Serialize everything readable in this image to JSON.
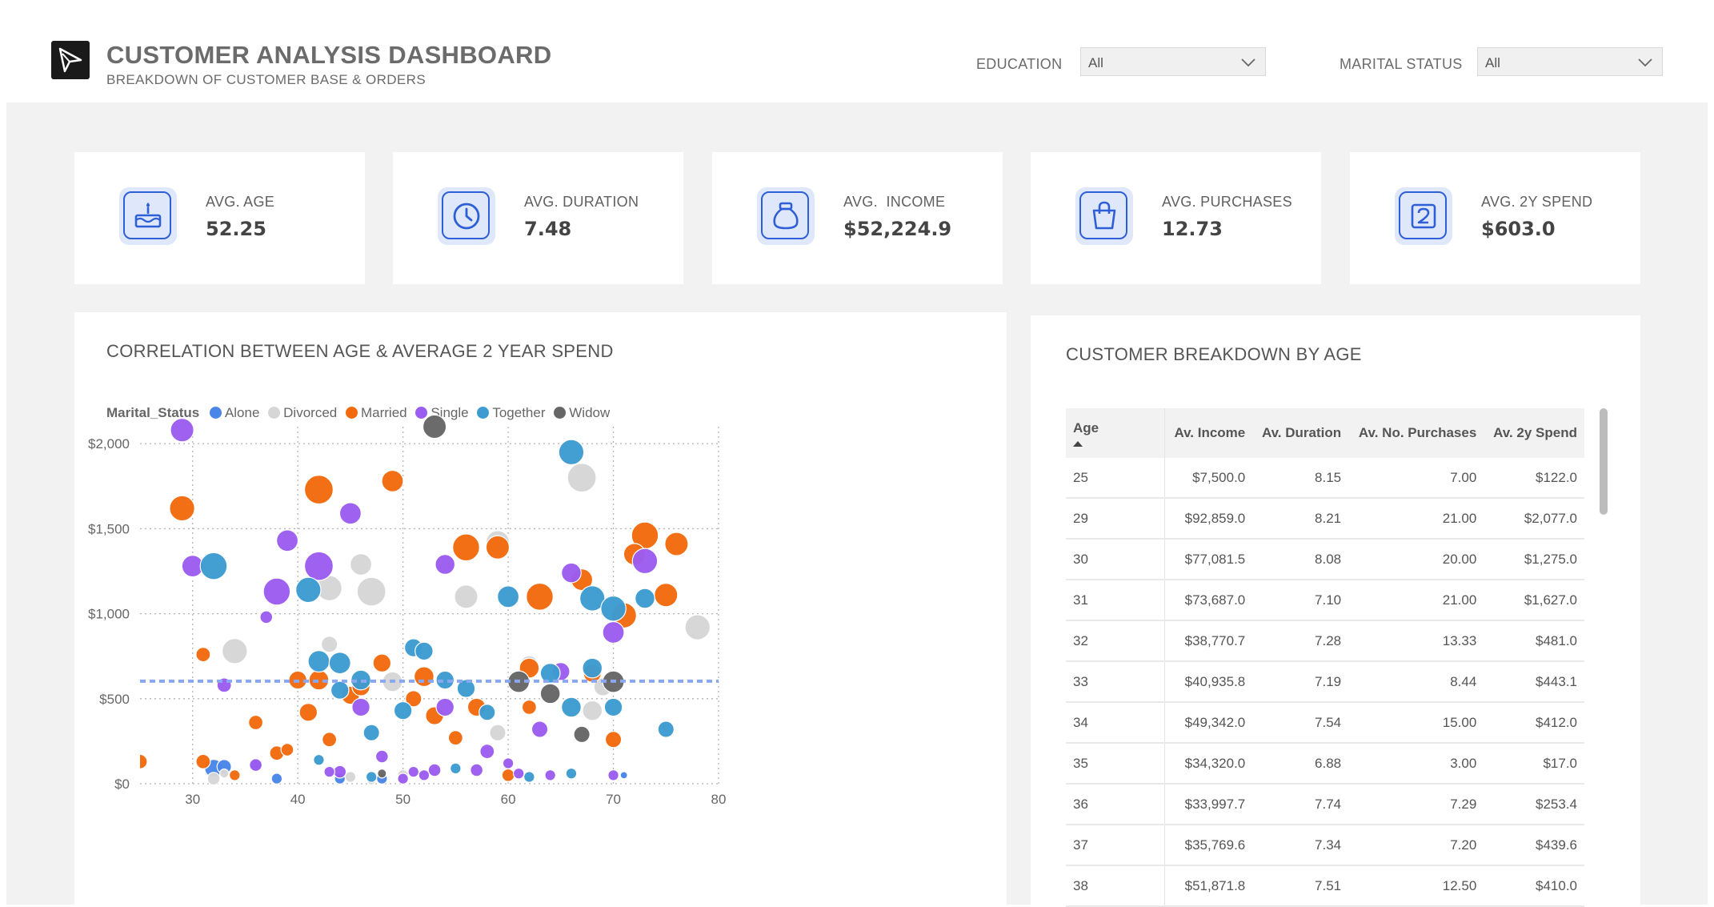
{
  "header": {
    "title": "CUSTOMER ANALYSIS DASHBOARD",
    "subtitle": "BREAKDOWN OF CUSTOMER BASE & ORDERS",
    "filters": [
      {
        "label": "EDUCATION",
        "value": "All"
      },
      {
        "label": "MARITAL STATUS",
        "value": "All"
      }
    ]
  },
  "kpis": [
    {
      "label": "AVG. AGE",
      "value": "52.25",
      "icon": "cake-icon"
    },
    {
      "label": "AVG. DURATION",
      "value": "7.48",
      "icon": "clock-icon"
    },
    {
      "label": "AVG.  INCOME",
      "value": "$52,224.9",
      "icon": "money-bag-icon"
    },
    {
      "label": "AVG. PURCHASES",
      "value": "12.73",
      "icon": "shopping-bag-icon"
    },
    {
      "label": "AVG. 2Y SPEND",
      "value": "$603.0",
      "icon": "number-two-icon"
    }
  ],
  "colors": {
    "Alone": "#4a86e8",
    "Divorced": "#d6d6d6",
    "Married": "#f26a0d",
    "Single": "#9b5cf0",
    "Together": "#3d9bd1",
    "Widow": "#666666",
    "avg_line": "#8aa8f2",
    "kpi_icon": "#2f5fd6"
  },
  "scatter": {
    "title": "CORRELATION BETWEEN AGE & AVERAGE 2 YEAR SPEND",
    "legend_title": "Marital_Status",
    "categories": [
      "Alone",
      "Divorced",
      "Married",
      "Single",
      "Together",
      "Widow"
    ]
  },
  "chart_data": {
    "type": "scatter",
    "xlim": [
      25,
      80
    ],
    "ylim": [
      0,
      2100
    ],
    "x_ticks": [
      30,
      40,
      50,
      60,
      70,
      80
    ],
    "y_ticks": [
      0,
      500,
      1000,
      1500,
      2000
    ],
    "y_tick_labels": [
      "$0",
      "$500",
      "$1,000",
      "$1,500",
      "$2,000"
    ],
    "grid": true,
    "legend_position": "top-left",
    "average_line": 603,
    "series": [
      {
        "name": "Alone",
        "points": [
          [
            32,
            90,
            10
          ],
          [
            71,
            50,
            4
          ],
          [
            48,
            30,
            6
          ],
          [
            44,
            30,
            6
          ],
          [
            38,
            30,
            6
          ],
          [
            33,
            100,
            8
          ],
          [
            36,
            110,
            7
          ]
        ]
      },
      {
        "name": "Divorced",
        "points": [
          [
            67,
            1800,
            16
          ],
          [
            78,
            920,
            14
          ],
          [
            59,
            1420,
            13
          ],
          [
            43,
            1150,
            14
          ],
          [
            47,
            1130,
            16
          ],
          [
            46,
            1290,
            12
          ],
          [
            56,
            1100,
            13
          ],
          [
            34,
            780,
            14
          ],
          [
            43,
            820,
            9
          ],
          [
            68,
            430,
            11
          ],
          [
            49,
            600,
            11
          ],
          [
            69,
            570,
            10
          ],
          [
            59,
            300,
            9
          ],
          [
            62,
            700,
            10
          ],
          [
            32,
            30,
            7
          ],
          [
            50,
            50,
            6
          ],
          [
            47,
            20,
            5
          ],
          [
            45,
            40,
            6
          ],
          [
            33,
            60,
            5
          ]
        ]
      },
      {
        "name": "Married",
        "points": [
          [
            29,
            1620,
            14
          ],
          [
            42,
            1730,
            16
          ],
          [
            49,
            1780,
            12
          ],
          [
            56,
            1390,
            15
          ],
          [
            59,
            1390,
            13
          ],
          [
            63,
            1100,
            15
          ],
          [
            67,
            1200,
            12
          ],
          [
            71,
            990,
            14
          ],
          [
            73,
            1460,
            15
          ],
          [
            76,
            1410,
            13
          ],
          [
            75,
            1110,
            13
          ],
          [
            72,
            1350,
            12
          ],
          [
            31,
            760,
            8
          ],
          [
            40,
            610,
            10
          ],
          [
            41,
            420,
            10
          ],
          [
            36,
            360,
            8
          ],
          [
            38,
            180,
            8
          ],
          [
            39,
            200,
            7
          ],
          [
            43,
            260,
            8
          ],
          [
            45,
            520,
            10
          ],
          [
            46,
            570,
            10
          ],
          [
            48,
            710,
            10
          ],
          [
            51,
            500,
            9
          ],
          [
            53,
            400,
            10
          ],
          [
            55,
            270,
            8
          ],
          [
            57,
            450,
            10
          ],
          [
            62,
            450,
            8
          ],
          [
            68,
            650,
            10
          ],
          [
            70,
            260,
            9
          ],
          [
            62,
            680,
            11
          ],
          [
            52,
            630,
            11
          ],
          [
            25,
            130,
            8
          ],
          [
            31,
            130,
            8
          ],
          [
            34,
            50,
            6
          ],
          [
            60,
            50,
            7
          ],
          [
            42,
            610,
            11
          ]
        ]
      },
      {
        "name": "Single",
        "points": [
          [
            29,
            2080,
            13
          ],
          [
            30,
            1280,
            12
          ],
          [
            38,
            1130,
            15
          ],
          [
            39,
            1430,
            12
          ],
          [
            42,
            1280,
            16
          ],
          [
            45,
            1590,
            12
          ],
          [
            37,
            980,
            7
          ],
          [
            54,
            1290,
            11
          ],
          [
            66,
            1240,
            11
          ],
          [
            73,
            1310,
            14
          ],
          [
            70,
            890,
            12
          ],
          [
            33,
            580,
            8
          ],
          [
            46,
            450,
            10
          ],
          [
            54,
            450,
            10
          ],
          [
            58,
            190,
            8
          ],
          [
            63,
            320,
            9
          ],
          [
            65,
            660,
            10
          ],
          [
            48,
            160,
            7
          ],
          [
            36,
            110,
            7
          ],
          [
            44,
            70,
            7
          ],
          [
            43,
            70,
            6
          ],
          [
            53,
            80,
            7
          ],
          [
            52,
            50,
            6
          ],
          [
            57,
            80,
            7
          ],
          [
            61,
            60,
            6
          ],
          [
            64,
            50,
            6
          ],
          [
            70,
            50,
            6
          ],
          [
            50,
            30,
            6
          ],
          [
            51,
            70,
            6
          ],
          [
            60,
            120,
            6
          ]
        ]
      },
      {
        "name": "Together",
        "points": [
          [
            32,
            1280,
            15
          ],
          [
            41,
            1140,
            14
          ],
          [
            66,
            1950,
            14
          ],
          [
            60,
            1100,
            12
          ],
          [
            68,
            1090,
            14
          ],
          [
            70,
            1030,
            14
          ],
          [
            73,
            1090,
            11
          ],
          [
            42,
            720,
            12
          ],
          [
            44,
            710,
            12
          ],
          [
            46,
            610,
            11
          ],
          [
            51,
            800,
            10
          ],
          [
            52,
            780,
            10
          ],
          [
            54,
            610,
            10
          ],
          [
            56,
            560,
            10
          ],
          [
            58,
            420,
            9
          ],
          [
            50,
            430,
            10
          ],
          [
            44,
            550,
            10
          ],
          [
            47,
            300,
            9
          ],
          [
            64,
            650,
            11
          ],
          [
            66,
            450,
            11
          ],
          [
            68,
            680,
            11
          ],
          [
            70,
            450,
            10
          ],
          [
            75,
            320,
            9
          ],
          [
            62,
            40,
            6
          ],
          [
            66,
            60,
            6
          ],
          [
            55,
            90,
            6
          ],
          [
            47,
            40,
            6
          ],
          [
            42,
            140,
            6
          ]
        ]
      },
      {
        "name": "Widow",
        "points": [
          [
            53,
            2100,
            13
          ],
          [
            61,
            600,
            12
          ],
          [
            64,
            530,
            11
          ],
          [
            70,
            600,
            12
          ],
          [
            67,
            290,
            9
          ],
          [
            48,
            60,
            5
          ]
        ]
      }
    ]
  },
  "table": {
    "title": "CUSTOMER BREAKDOWN BY AGE",
    "columns": [
      "Age",
      "Av. Income",
      "Av. Duration",
      "Av. No. Purchases",
      "Av. 2y Spend"
    ],
    "rows": [
      [
        "25",
        "$7,500.0",
        "8.15",
        "7.00",
        "$122.0"
      ],
      [
        "29",
        "$92,859.0",
        "8.21",
        "21.00",
        "$2,077.0"
      ],
      [
        "30",
        "$77,081.5",
        "8.08",
        "20.00",
        "$1,275.0"
      ],
      [
        "31",
        "$73,687.0",
        "7.10",
        "21.00",
        "$1,627.0"
      ],
      [
        "32",
        "$38,770.7",
        "7.28",
        "13.33",
        "$481.0"
      ],
      [
        "33",
        "$40,935.8",
        "7.19",
        "8.44",
        "$443.1"
      ],
      [
        "34",
        "$49,342.0",
        "7.54",
        "15.00",
        "$412.0"
      ],
      [
        "35",
        "$34,320.0",
        "6.88",
        "3.00",
        "$17.0"
      ],
      [
        "36",
        "$33,997.7",
        "7.74",
        "7.29",
        "$253.4"
      ],
      [
        "37",
        "$35,769.6",
        "7.34",
        "7.20",
        "$439.6"
      ],
      [
        "38",
        "$51,871.8",
        "7.51",
        "12.50",
        "$410.0"
      ]
    ]
  }
}
